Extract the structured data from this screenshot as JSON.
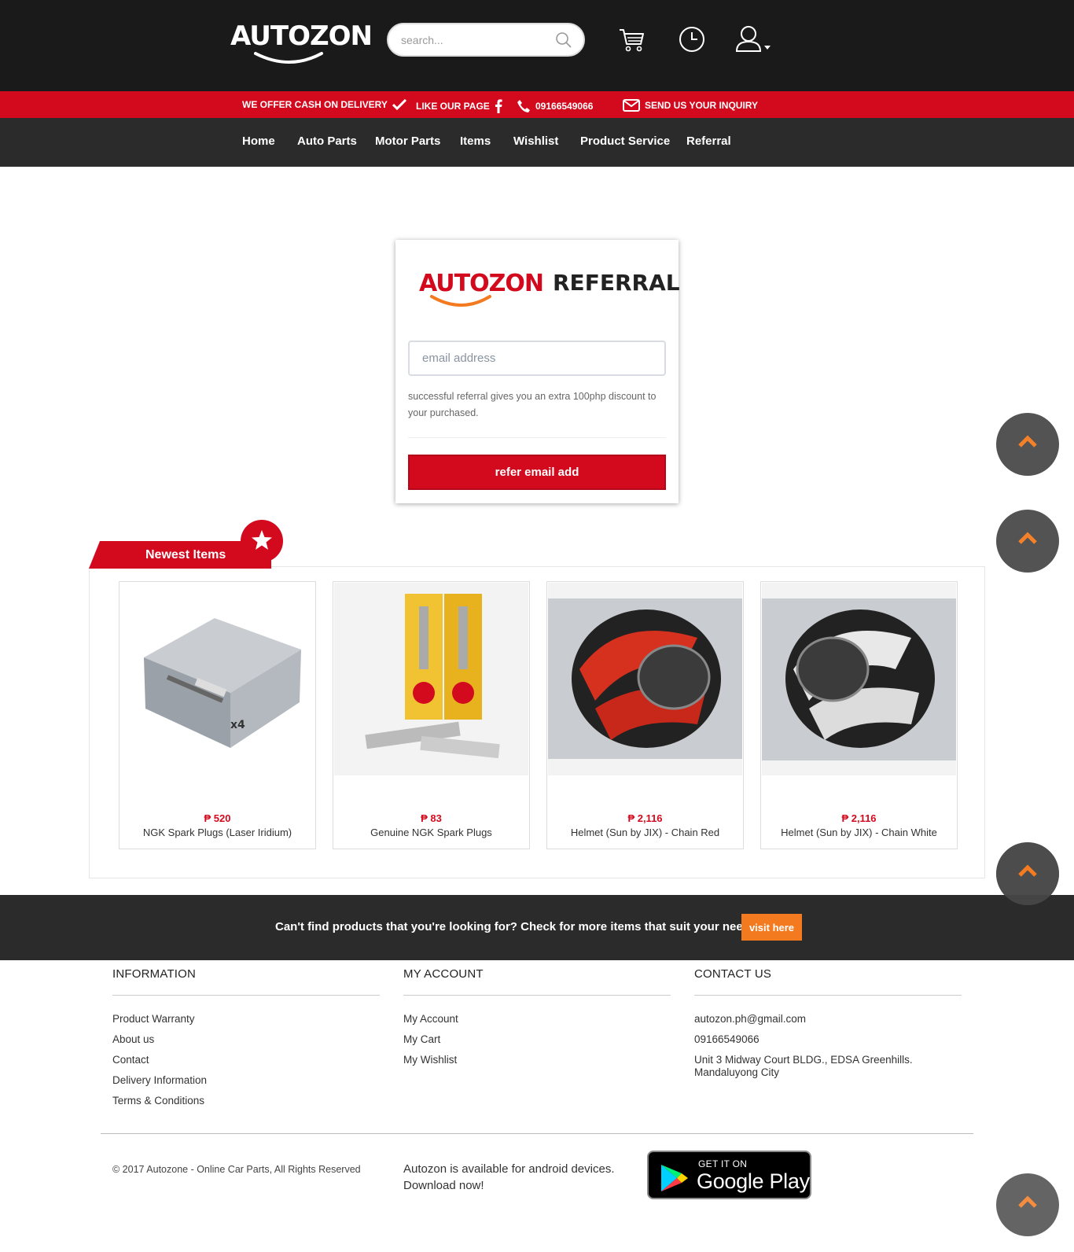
{
  "header": {
    "logo_text": "AUTOZON",
    "search_placeholder": "search..."
  },
  "promo_bar": {
    "cod": "WE OFFER CASH ON DELIVERY",
    "like": "LIKE OUR PAGE",
    "phone": "09166549066",
    "inquiry": "SEND US YOUR INQUIRY"
  },
  "nav": {
    "items": [
      "Home",
      "Auto Parts",
      "Motor Parts",
      "Items",
      "Wishlist",
      "Product Service",
      "Referral"
    ]
  },
  "referral": {
    "logo_text": "AUTOZON",
    "logo_suffix": "REFERRAL",
    "email_placeholder": "email address",
    "note": "successful referral gives you an extra 100php discount to your purchased.",
    "button": "refer email add"
  },
  "newest": {
    "title": "Newest Items",
    "products": [
      {
        "price": "₱ 520",
        "name": "NGK Spark Plugs (Laser Iridium)"
      },
      {
        "price": "₱ 83",
        "name": "Genuine NGK Spark Plugs"
      },
      {
        "price": "₱ 2,116",
        "name": "Helmet (Sun by JIX) - Chain Red"
      },
      {
        "price": "₱ 2,116",
        "name": "Helmet (Sun by JIX) - Chain White"
      }
    ]
  },
  "cta": {
    "text": "Can't find products that you're looking for? Check for more items that suit your needs.",
    "button": "visit here"
  },
  "footer": {
    "information": {
      "title": "INFORMATION",
      "links": [
        "Product Warranty",
        "About us",
        "Contact",
        "Delivery Information",
        "Terms & Conditions"
      ]
    },
    "account": {
      "title": "MY ACCOUNT",
      "links": [
        "My Account",
        "My Cart",
        "My Wishlist"
      ]
    },
    "contact": {
      "title": "CONTACT US",
      "email": "autozon.ph@gmail.com",
      "phone": "09166549066",
      "address": "Unit 3 Midway Court BLDG., EDSA Greenhills. Mandaluyong City"
    },
    "copyright": "© 2017 Autozone - Online Car Parts, All Rights Reserved",
    "android_line1": "Autozon is available for android devices.",
    "android_line2": "Download now!",
    "gplay_small": "GET IT ON",
    "gplay_big": "Google Play"
  },
  "colors": {
    "brand_red": "#d30a1e",
    "header_dark": "#1a1a1a",
    "nav_dark": "#2b2b2b",
    "accent_orange": "#f47a1f"
  }
}
